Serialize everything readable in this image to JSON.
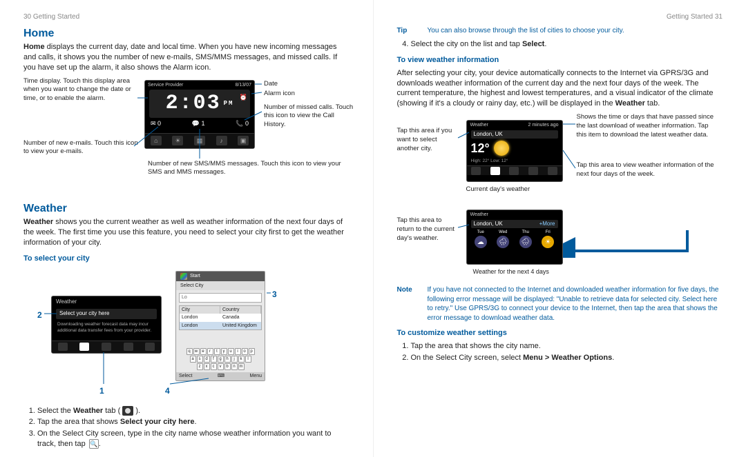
{
  "pageLeft": {
    "header": "30  Getting Started",
    "home": {
      "title": "Home",
      "bodyPrefix": "Home",
      "body": " displays the current day, date and local time. When you have new incoming messages and calls, it shows you the number of new e-mails, SMS/MMS messages, and missed calls. If you have set up the alarm, it also shows the Alarm icon.",
      "callouts": {
        "timeDisplay": "Time display. Touch this display area when you want to change the date or time, or to enable the alarm.",
        "date": "Date",
        "alarmIcon": "Alarm icon",
        "missedCalls": "Number of missed calls. Touch this icon to view the Call History.",
        "newEmails": "Number of new e-mails. Touch this icon to view your e-mails.",
        "newSms": "Number of new SMS/MMS messages. Touch this icon to view your SMS and MMS messages."
      },
      "screen": {
        "provider": "Service Provider",
        "date": "8/13/07",
        "clock": "2:03",
        "pm": "PM",
        "email_count": "0",
        "sms_count": "1",
        "call_count": "0"
      }
    },
    "weather": {
      "title": "Weather",
      "bodyPrefix": "Weather",
      "body": " shows you the current weather as well as weather information of the next four days of the week. The first time you use this feature, you need to select your city first to get the weather information of your city.",
      "selectCityHeading": "To select your city",
      "markers": {
        "m1": "1",
        "m2": "2",
        "m3": "3",
        "m4": "4"
      },
      "widget": {
        "title": "Weather",
        "selectHere": "Select your city here",
        "msg": "Downloading weather forecast data may incur additional data transfer fees from your provider."
      },
      "selectScreen": {
        "start": "Start",
        "title": "Select City",
        "col1": "City",
        "col2": "Country",
        "r1c1": "London",
        "r1c2": "Canada",
        "r2c1": "London",
        "r2c2": "United Kingdom",
        "input": "Lo",
        "bottom1": "Select",
        "bottom2": "Menu"
      },
      "steps": {
        "s1a": "Select the ",
        "s1b": "Weather",
        "s1c": " tab ( ",
        "s1d": " ).",
        "s2a": "Tap the area that shows ",
        "s2b": "Select your city here",
        "s2c": ".",
        "s3": "On the Select City screen, type in the city name whose weather information you want to track, then tap ",
        "s3b": "."
      }
    }
  },
  "pageRight": {
    "header": "Getting Started  31",
    "tip": {
      "label": "Tip",
      "body": "You can also browse through the list of cities to choose your city."
    },
    "step4a": "Select the city on the list and tap ",
    "step4b": "Select",
    "step4c": ".",
    "viewHeading": "To view weather information",
    "viewBodyA": "After selecting your city, your device automatically connects to the Internet via GPRS/3G and downloads weather information of the current day and the next four days of the week. The current temperature, the highest and lowest temperatures, and a visual indicator of the climate (showing if it's a cloudy or rainy day, etc.) will be displayed in the ",
    "viewBodyB": "Weather",
    "viewBodyC": " tab.",
    "fig1": {
      "tapCity": "Tap this area if you want to select another city.",
      "lastDl": "Shows the time or days that have passed since the last download of weather information. Tap this item to download the latest weather data.",
      "viewNext": "Tap this area to view weather information of the next four days of the week.",
      "currentDay": "Current day's weather",
      "screen": {
        "title": "Weather",
        "ago": "2 minutes ago",
        "city": "London, UK",
        "temp": "12°",
        "hl": "High: 22°   Low: 12°"
      }
    },
    "fig2": {
      "tapReturn": "Tap this area to return to the current day's weather.",
      "caption": "Weather for the next 4 days",
      "screen": {
        "title": "Weather",
        "city": "London, UK",
        "more": "+More",
        "days": [
          "Tue",
          "Wed",
          "Thu",
          "Fri"
        ]
      }
    },
    "note": {
      "label": "Note",
      "body": "If you have not connected to the Internet and downloaded weather information for five days, the following error message will be displayed: \"Unable to retrieve data for selected city. Select here to retry.\" Use GPRS/3G to connect your device to the Internet, then tap the area that shows the error message to download weather data."
    },
    "customizeHeading": "To customize weather settings",
    "custStep1": "Tap the area that shows the city name.",
    "custStep2a": "On the Select City screen, select ",
    "custStep2b": "Menu > Weather Options",
    "custStep2c": "."
  }
}
